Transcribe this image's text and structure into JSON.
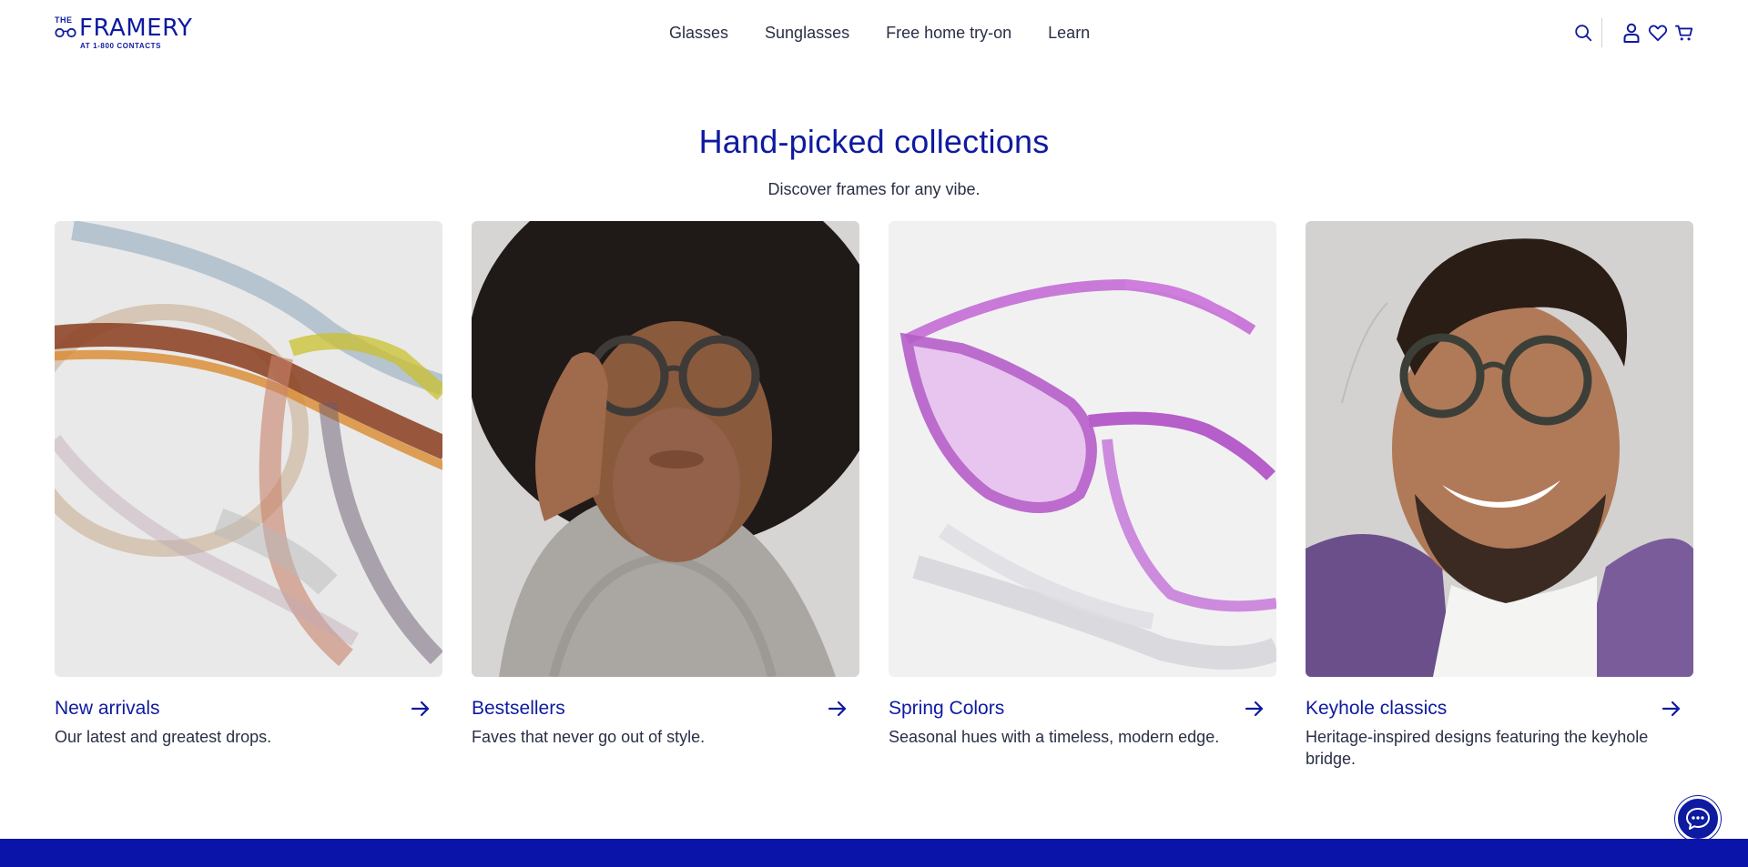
{
  "brand": {
    "the": "THE",
    "name": "FRAMERY",
    "sub": "AT 1-800 CONTACTS",
    "color": "#0e1aa0"
  },
  "nav": {
    "items": [
      {
        "label": "Glasses"
      },
      {
        "label": "Sunglasses"
      },
      {
        "label": "Free home try-on"
      },
      {
        "label": "Learn"
      }
    ]
  },
  "header_icons": [
    "search-icon",
    "account-icon",
    "heart-icon",
    "cart-icon"
  ],
  "section": {
    "title": "Hand-picked collections",
    "subtitle": "Discover frames for any vibe."
  },
  "collections": [
    {
      "title": "New arrivals",
      "description": "Our latest and greatest drops.",
      "image": "tortoise multicolor frames close-up"
    },
    {
      "title": "Bestsellers",
      "description": "Faves that never go out of style.",
      "image": "woman wearing round tortoise glasses"
    },
    {
      "title": "Spring Colors",
      "description": "Seasonal hues with a timeless, modern edge.",
      "image": "purple cat-eye frames"
    },
    {
      "title": "Keyhole classics",
      "description": "Heritage-inspired designs featuring the keyhole bridge.",
      "image": "smiling man wearing round glasses"
    }
  ],
  "colors": {
    "accent": "#0e1aa0",
    "footer": "#0a14a8",
    "text": "#2a2f45"
  }
}
